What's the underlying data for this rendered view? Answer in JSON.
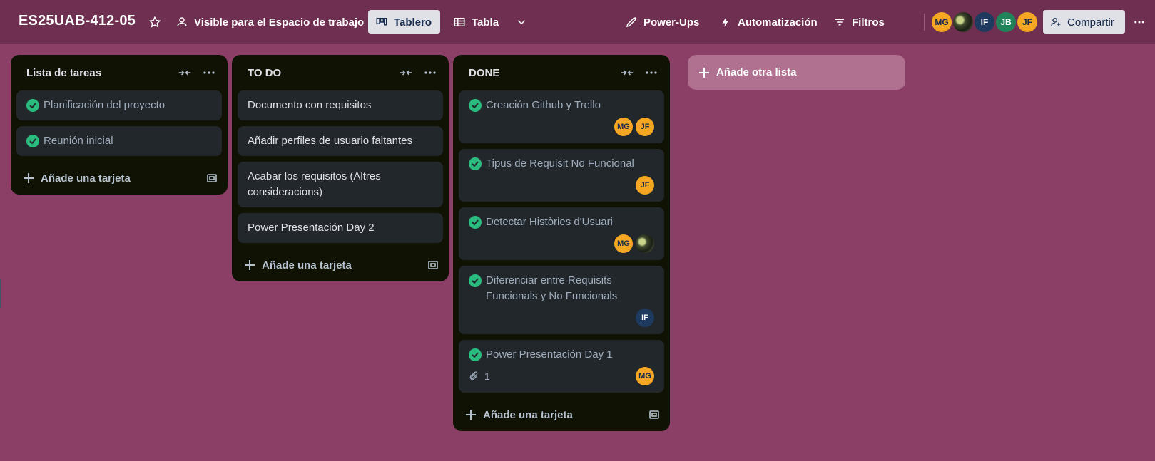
{
  "header": {
    "board_title": "ES25UAB-412-05",
    "visibility_label": "Visible para el Espacio de trabajo",
    "view_board_label": "Tablero",
    "view_table_label": "Tabla",
    "powerups_label": "Power-Ups",
    "automation_label": "Automatización",
    "filters_label": "Filtros",
    "share_label": "Compartir",
    "members": [
      "MG",
      "",
      "IF",
      "JB",
      "JF"
    ]
  },
  "lists": [
    {
      "title": "Lista de tareas",
      "add_card_label": "Añade una tarjeta",
      "cards": [
        {
          "text": "Planificación del proyecto",
          "done": true
        },
        {
          "text": "Reunión inicial",
          "done": true
        }
      ]
    },
    {
      "title": "TO DO",
      "add_card_label": "Añade una tarjeta",
      "cards": [
        {
          "text": "Documento con requisitos"
        },
        {
          "text": "Añadir perfiles de usuario faltantes"
        },
        {
          "text": "Acabar los requisitos (Altres consideracions)"
        },
        {
          "text": "Power Presentación Day 2"
        }
      ]
    },
    {
      "title": "DONE",
      "add_card_label": "Añade una tarjeta",
      "cards": [
        {
          "text": "Creación Github y Trello",
          "done": true,
          "members": [
            "MG",
            "JF"
          ]
        },
        {
          "text": "Tipus de Requisit No Funcional",
          "done": true,
          "members": [
            "JF"
          ]
        },
        {
          "text": "Detectar Històries d'Usuari",
          "done": true,
          "members": [
            "MG",
            ""
          ]
        },
        {
          "text": "Diferenciar entre Requisits Funcionals y No Funcionals",
          "done": true,
          "members": [
            "IF"
          ]
        },
        {
          "text": "Power Presentación Day 1",
          "done": true,
          "attachments": "1",
          "members": [
            "MG"
          ]
        }
      ]
    }
  ],
  "add_list_label": "Añade otra lista",
  "colors": {
    "board_bg": "#8c3f66",
    "header_bg": "#6e2f50",
    "list_bg": "#101204",
    "card_bg": "#22272b",
    "check_green": "#2abb7f",
    "avatar_orange": "#f5a623"
  }
}
